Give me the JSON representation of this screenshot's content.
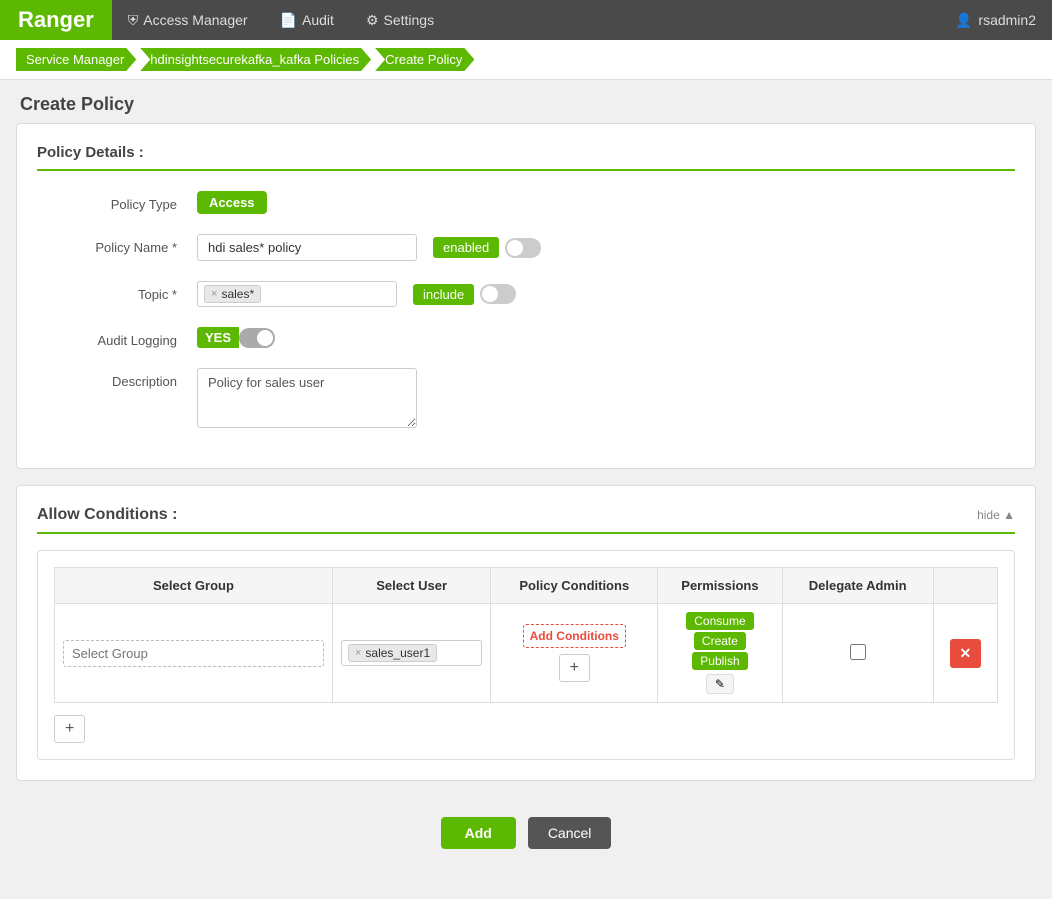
{
  "brand": "Ranger",
  "nav": {
    "items": [
      {
        "id": "access-manager",
        "label": "Access Manager",
        "icon": "shield"
      },
      {
        "id": "audit",
        "label": "Audit",
        "icon": "file"
      },
      {
        "id": "settings",
        "label": "Settings",
        "icon": "gear"
      }
    ],
    "user": "rsadmin2"
  },
  "breadcrumb": {
    "items": [
      {
        "label": "Service Manager"
      },
      {
        "label": "hdinsightsecurekafka_kafka Policies"
      },
      {
        "label": "Create Policy"
      }
    ]
  },
  "page_title": "Create Policy",
  "policy_details": {
    "section_title": "Policy Details :",
    "policy_type_label": "Policy Type",
    "policy_type_value": "Access",
    "policy_name_label": "Policy Name *",
    "policy_name_value": "hdi sales* policy",
    "policy_name_placeholder": "hdi sales* policy",
    "enabled_label": "enabled",
    "topic_label": "Topic *",
    "topic_tag": "sales*",
    "include_label": "include",
    "audit_logging_label": "Audit Logging",
    "audit_yes_label": "YES",
    "description_label": "Description",
    "description_value": "Policy for sales user",
    "description_placeholder": "Policy for sales user"
  },
  "allow_conditions": {
    "section_title": "Allow Conditions :",
    "hide_label": "hide ▲",
    "table": {
      "col_select_group": "Select Group",
      "col_select_user": "Select User",
      "col_policy_conditions": "Policy Conditions",
      "col_permissions": "Permissions",
      "col_delegate_admin": "Delegate Admin",
      "row": {
        "group_placeholder": "Select Group",
        "user_tag": "sales_user1",
        "add_conditions_label": "Add Conditions",
        "permissions": [
          "Consume",
          "Create",
          "Publish"
        ],
        "edit_btn_label": "✎",
        "plus_btn": "+"
      }
    },
    "add_row_btn": "+"
  },
  "footer": {
    "add_label": "Add",
    "cancel_label": "Cancel"
  }
}
